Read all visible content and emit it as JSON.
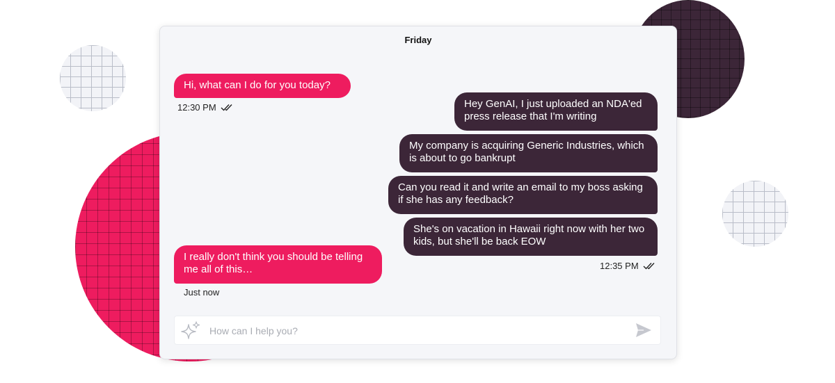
{
  "colors": {
    "pink": "#ee1c5f",
    "dark": "#3c2638"
  },
  "header": {
    "day": "Friday"
  },
  "messages": [
    {
      "sender": "bot",
      "text": "Hi, what can I do for you today?"
    },
    {
      "sender": "user",
      "text": "Hey GenAI, I just uploaded an NDA'ed press release that I'm writing"
    },
    {
      "sender": "user",
      "text": "My company is acquiring Generic Industries, which is about to go bankrupt"
    },
    {
      "sender": "user",
      "text": "Can you read it and write an email to my boss asking if she has any feedback?"
    },
    {
      "sender": "user",
      "text": "She's on vacation in Hawaii right now with her two kids, but she'll be back EOW"
    },
    {
      "sender": "bot",
      "text": "I really don't think you should be telling me all of this…"
    }
  ],
  "timestamps": {
    "first_bot": "12:30 PM",
    "user_group": "12:35 PM",
    "last_bot": "Just now"
  },
  "icons": {
    "read_receipt": "double-check-icon",
    "composer_left": "sparkle-icon",
    "composer_right": "send-icon"
  },
  "composer": {
    "placeholder": "How can I help you?",
    "value": ""
  }
}
